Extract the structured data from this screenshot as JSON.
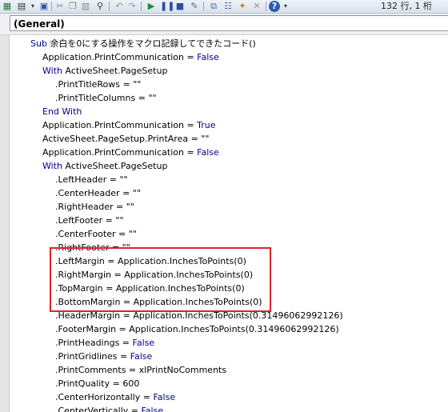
{
  "toolbar": {
    "status_text": "132 行, 1 桁"
  },
  "object_box": {
    "value": "(General)"
  },
  "code_lines": [
    {
      "indent": 0,
      "parts": [
        {
          "t": "Sub ",
          "kw": true
        },
        {
          "t": "余白を0にする操作をマクロ記録してできたコード()"
        }
      ]
    },
    {
      "indent": 1,
      "parts": [
        {
          "t": "Application.PrintCommunication = "
        },
        {
          "t": "False",
          "kw": true
        }
      ]
    },
    {
      "indent": 1,
      "parts": [
        {
          "t": "With",
          "kw": true
        },
        {
          "t": " ActiveSheet.PageSetup"
        }
      ]
    },
    {
      "indent": 2,
      "parts": [
        {
          "t": ".PrintTitleRows = \"\""
        }
      ]
    },
    {
      "indent": 2,
      "parts": [
        {
          "t": ".PrintTitleColumns = \"\""
        }
      ]
    },
    {
      "indent": 1,
      "parts": [
        {
          "t": "End With",
          "kw": true
        }
      ]
    },
    {
      "indent": 1,
      "parts": [
        {
          "t": "Application.PrintCommunication = "
        },
        {
          "t": "True",
          "kw": true
        }
      ]
    },
    {
      "indent": 1,
      "parts": [
        {
          "t": "ActiveSheet.PageSetup.PrintArea = \"\""
        }
      ]
    },
    {
      "indent": 1,
      "parts": [
        {
          "t": "Application.PrintCommunication = "
        },
        {
          "t": "False",
          "kw": true
        }
      ]
    },
    {
      "indent": 1,
      "parts": [
        {
          "t": "With",
          "kw": true
        },
        {
          "t": " ActiveSheet.PageSetup"
        }
      ]
    },
    {
      "indent": 2,
      "parts": [
        {
          "t": ".LeftHeader = \"\""
        }
      ]
    },
    {
      "indent": 2,
      "parts": [
        {
          "t": ".CenterHeader = \"\""
        }
      ]
    },
    {
      "indent": 2,
      "parts": [
        {
          "t": ".RightHeader = \"\""
        }
      ]
    },
    {
      "indent": 2,
      "parts": [
        {
          "t": ".LeftFooter = \"\""
        }
      ]
    },
    {
      "indent": 2,
      "parts": [
        {
          "t": ".CenterFooter = \"\""
        }
      ]
    },
    {
      "indent": 2,
      "parts": [
        {
          "t": ".RightFooter = \"\""
        }
      ]
    },
    {
      "indent": 2,
      "parts": [
        {
          "t": ".LeftMargin = Application.InchesToPoints(0)"
        }
      ]
    },
    {
      "indent": 2,
      "parts": [
        {
          "t": ".RightMargin = Application.InchesToPoints(0)"
        }
      ]
    },
    {
      "indent": 2,
      "parts": [
        {
          "t": ".TopMargin = Application.InchesToPoints(0)"
        }
      ]
    },
    {
      "indent": 2,
      "parts": [
        {
          "t": ".BottomMargin = Application.InchesToPoints(0)"
        }
      ]
    },
    {
      "indent": 2,
      "parts": [
        {
          "t": ".HeaderMargin = Application.InchesToPoints(0.31496062992126)"
        }
      ]
    },
    {
      "indent": 2,
      "parts": [
        {
          "t": ".FooterMargin = Application.InchesToPoints(0.31496062992126)"
        }
      ]
    },
    {
      "indent": 2,
      "parts": [
        {
          "t": ".PrintHeadings = "
        },
        {
          "t": "False",
          "kw": true
        }
      ]
    },
    {
      "indent": 2,
      "parts": [
        {
          "t": ".PrintGridlines = "
        },
        {
          "t": "False",
          "kw": true
        }
      ]
    },
    {
      "indent": 2,
      "parts": [
        {
          "t": ".PrintComments = xlPrintNoComments"
        }
      ]
    },
    {
      "indent": 2,
      "parts": [
        {
          "t": ".PrintQuality = 600"
        }
      ]
    },
    {
      "indent": 2,
      "parts": [
        {
          "t": ".CenterHorizontally = "
        },
        {
          "t": "False",
          "kw": true
        }
      ]
    },
    {
      "indent": 2,
      "parts": [
        {
          "t": ".CenterVertically = "
        },
        {
          "t": "False",
          "kw": true
        }
      ]
    }
  ],
  "colors": {
    "keyword": "#00008b",
    "highlight_box": "#e0202e"
  }
}
